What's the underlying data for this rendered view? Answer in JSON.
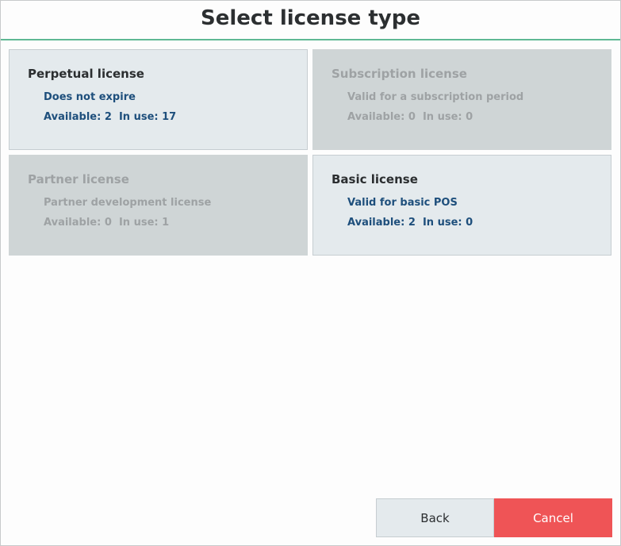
{
  "dialog": {
    "title": "Select license type"
  },
  "licenses": [
    {
      "title": "Perpetual license",
      "description": "Does not expire",
      "available_label": "Available:",
      "available": "2",
      "in_use_label": "In use:",
      "in_use": "17",
      "enabled": true
    },
    {
      "title": "Subscription license",
      "description": "Valid for a subscription period",
      "available_label": "Available:",
      "available": "0",
      "in_use_label": "In use:",
      "in_use": "0",
      "enabled": false
    },
    {
      "title": "Partner license",
      "description": "Partner development license",
      "available_label": "Available:",
      "available": "0",
      "in_use_label": "In use:",
      "in_use": "1",
      "enabled": false
    },
    {
      "title": "Basic license",
      "description": "Valid for basic POS",
      "available_label": "Available:",
      "available": "2",
      "in_use_label": "In use:",
      "in_use": "0",
      "enabled": true
    }
  ],
  "buttons": {
    "back_label": "Back",
    "cancel_label": "Cancel"
  },
  "colors": {
    "accent_line": "#5fb894",
    "card_enabled": "#e4eaed",
    "card_disabled": "#cfd5d6",
    "text_link": "#1e4f7c",
    "cancel": "#ef5456"
  }
}
